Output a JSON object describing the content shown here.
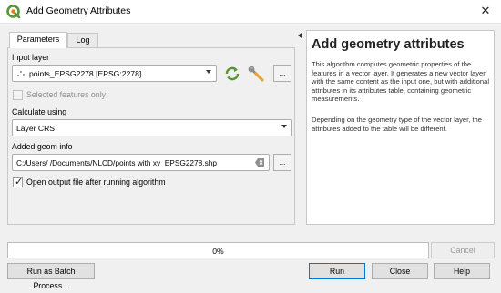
{
  "window": {
    "title": "Add Geometry Attributes",
    "close_glyph": "✕"
  },
  "tabs": [
    {
      "label": "Parameters",
      "active": true
    },
    {
      "label": "Log",
      "active": false
    }
  ],
  "params": {
    "input_layer_label": "Input layer",
    "input_layer_value": "points_EPSG2278 [EPSG:2278]",
    "selected_only_label": "Selected features only",
    "selected_only_checked": false,
    "calc_using_label": "Calculate using",
    "calc_using_value": "Layer CRS",
    "added_geom_label": "Added geom info",
    "added_geom_value": "C:/Users/      /Documents/NLCD/points with xy_EPSG2278.shp",
    "open_output_label": "Open output file after running algorithm",
    "open_output_checked": true,
    "ellipsis": "..."
  },
  "help": {
    "title": "Add geometry attributes",
    "p1": "This algorithm computes geometric properties of the features in a vector layer. It generates a new vector layer with the same content as the input one, but with additional attributes in its attributes table, containing geometric measurements.",
    "p2": "Depending on the geometry type of the vector layer, the attributes added to the table will be different."
  },
  "progress": {
    "value": 0,
    "text": "0%"
  },
  "buttons": {
    "cancel": "Cancel",
    "batch": "Run as Batch Process...",
    "run": "Run",
    "close": "Close",
    "help": "Help"
  },
  "colors": {
    "progress_fill": "#06b025",
    "qgis_green": "#589632",
    "help_title": "#222222"
  }
}
